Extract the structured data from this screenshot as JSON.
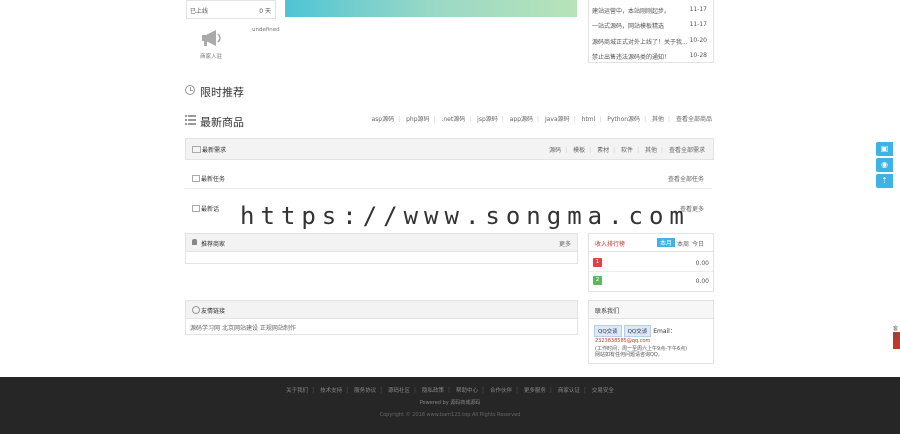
{
  "top": {
    "status_label": "已上线",
    "status_value": "0 天",
    "undefined_text": "undefined",
    "report_label": "商家入驻",
    "news": [
      {
        "title": "建站运营中，本站刚刚起步。",
        "date": "11-17"
      },
      {
        "title": "一站式源码，网站模板精选",
        "date": "11-17"
      },
      {
        "title": "源码商城正式对外上线了！关于我...",
        "date": "10-20"
      },
      {
        "title": "禁止出售违法源码类的通知！",
        "date": "10-28"
      }
    ]
  },
  "limited": {
    "title": "限时推荐"
  },
  "newest": {
    "title": "最新商品",
    "tags": [
      "asp源码",
      "php源码",
      ".net源码",
      "jsp源码",
      "app源码",
      "Java源码",
      "html",
      "Python源码",
      "其他",
      "查看全部商品"
    ]
  },
  "demand": {
    "title": "最新需求",
    "tabs": [
      "源码",
      "模板",
      "素材",
      "软件",
      "其他",
      "查看全部需求"
    ]
  },
  "task": {
    "title": "最新任务",
    "more": "查看全部任务"
  },
  "recent": {
    "title": "最新话",
    "more": "查看更多"
  },
  "watermark": "https://www.songma.com",
  "shops": {
    "title": "推荐商家",
    "more": "更多"
  },
  "rank": {
    "title": "收入排行榜",
    "tabs": [
      "本月",
      "本周",
      "今日"
    ],
    "rows": [
      {
        "rank": "1",
        "value": "0.00"
      },
      {
        "rank": "2",
        "value": "0.00"
      }
    ]
  },
  "friend": {
    "title": "友情链接",
    "links": [
      "源码学习网",
      "北京网站建设",
      "正规网站制作"
    ]
  },
  "contact": {
    "title": "联系我们",
    "qq1": "QQ交谈",
    "qq2": "QQ交谈",
    "email_label": "Email：",
    "email": "2323838585@qq.com",
    "note1": "(工作时间，周一至周六上午9点-下午6点)",
    "note2": "网站如有任何问题请咨询QQ。"
  },
  "footer": {
    "links": [
      "关于我们",
      "技术支持",
      "服务协议",
      "源码社区",
      "隐私政策",
      "帮助中心",
      "合作伙伴",
      "更多服务",
      "商家认证",
      "交易安全"
    ],
    "powered": "Powered by 源码商城源码",
    "copyright": "Copyright © 2018 www.bam123.top All Rights Reserved"
  },
  "side": {
    "icons": [
      "cart-icon",
      "eye-icon",
      "arrow-up-icon"
    ],
    "float_label": "客服"
  },
  "colors": {
    "accent": "#3fb3e3",
    "rank1": "#e0433b",
    "rank2": "#5cb85c",
    "footer_bg": "#262626",
    "contact_red": "#c0392b"
  }
}
